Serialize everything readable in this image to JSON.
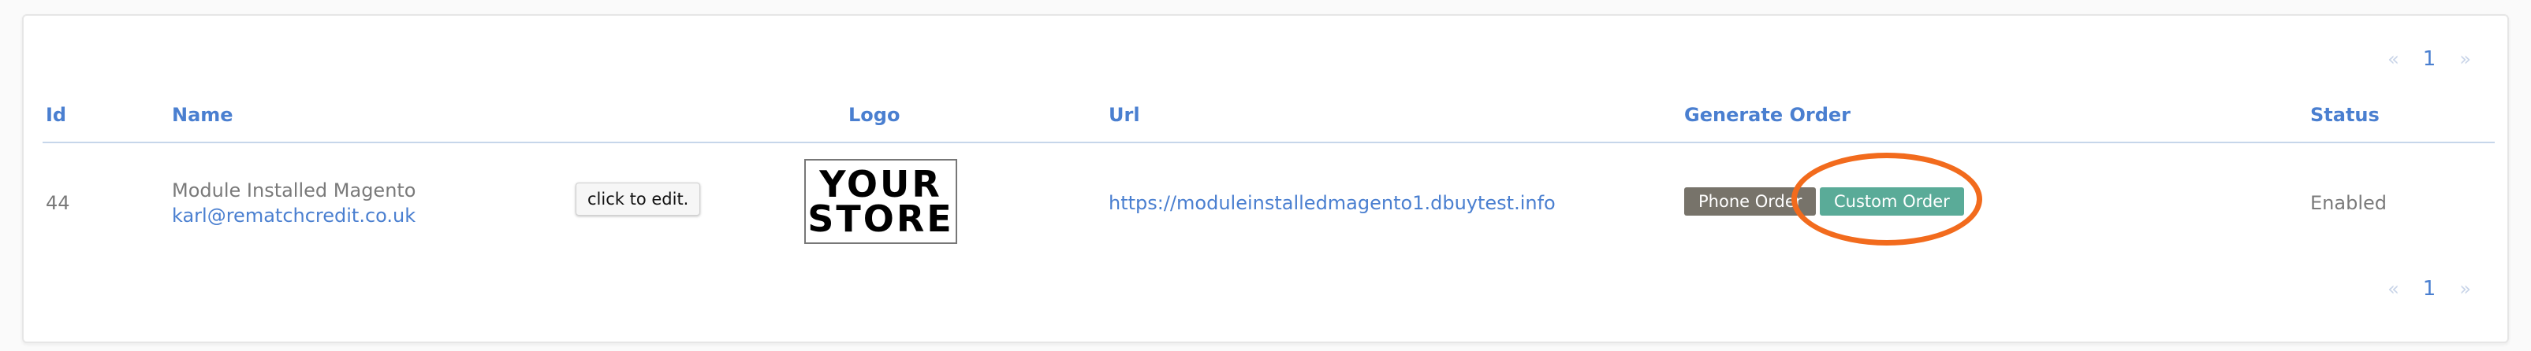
{
  "pagination": {
    "prev": "«",
    "page": "1",
    "next": "»"
  },
  "table": {
    "columns": [
      "Id",
      "Name",
      "Logo",
      "Url",
      "Generate Order",
      "Status"
    ],
    "rows": [
      {
        "id": "44",
        "name": "Module Installed Magento",
        "email": "karl@rematchcredit.co.uk",
        "logo_line1": "YOUR",
        "logo_line2": "STORE",
        "url": "https://moduleinstalledmagento1.dbuytest.info",
        "phone_order_label": "Phone Order",
        "custom_order_label": "Custom Order",
        "status": "Enabled"
      }
    ]
  },
  "tooltip": "click to edit.",
  "colors": {
    "accent": "#4a7fd0",
    "phone_button": "#77736a",
    "custom_button": "#5aab98",
    "highlight": "#f26b1d"
  }
}
